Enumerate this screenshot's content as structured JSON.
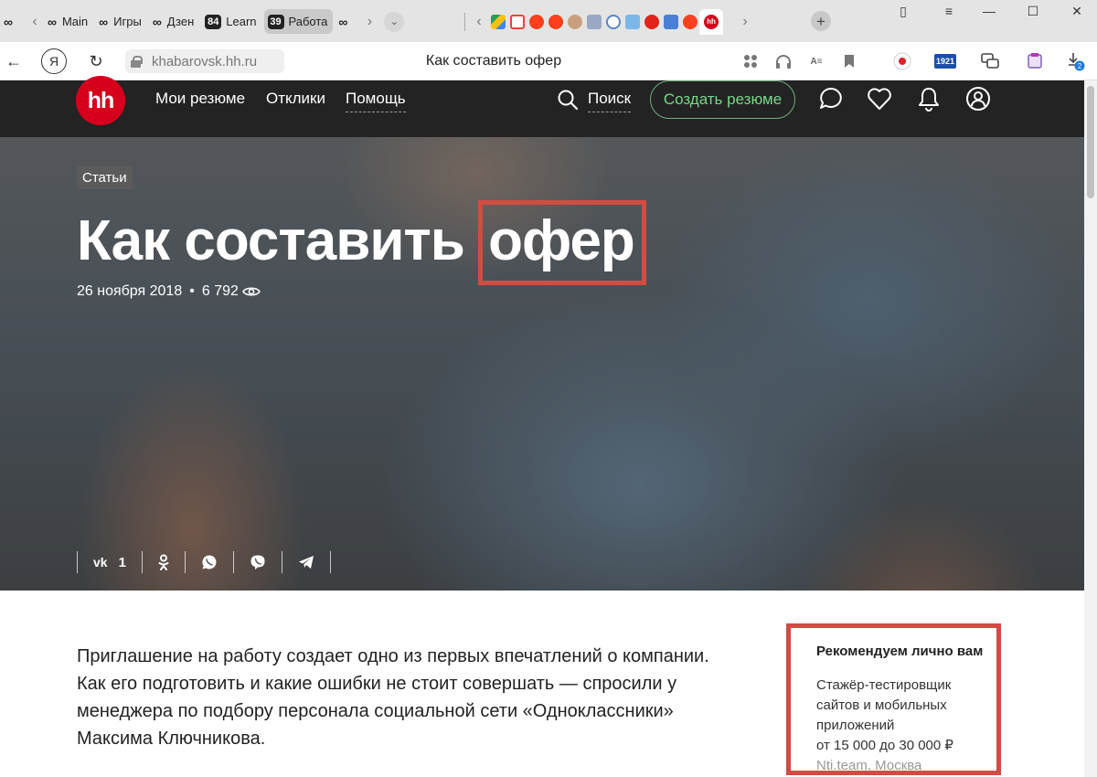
{
  "browser": {
    "tabs_left": [
      {
        "icon": "infinity-icon",
        "label": ""
      },
      {
        "icon": "infinity-icon",
        "label": "Main"
      },
      {
        "icon": "infinity-icon",
        "label": "Игры"
      },
      {
        "icon": "infinity-icon",
        "label": "Дзен"
      },
      {
        "badge": "84",
        "label": "Learn"
      },
      {
        "badge": "39",
        "label": "Работа"
      },
      {
        "icon": "infinity-icon",
        "label": ""
      }
    ],
    "pinned_favicons": [
      "google-drive",
      "gmail",
      "yandex",
      "yandex",
      "avatar",
      "image",
      "search",
      "snowflake",
      "yandex-browser",
      "docs",
      "yandex",
      "hh"
    ],
    "active_favicon_text": "hh",
    "new_tab": "+",
    "url": "khabarovsk.hh.ru",
    "page_title": "Как составить офер",
    "yandex_glyph": "Я",
    "calendar_badge": "1921",
    "download_count": "2"
  },
  "site": {
    "logo_text": "hh",
    "nav": {
      "resumes": "Мои резюме",
      "responses": "Отклики",
      "help": "Помощь"
    },
    "search_label": "Поиск",
    "create_resume": "Создать резюме",
    "colors": {
      "brand_red": "#d6001c",
      "accent_green": "#7ad58a",
      "highlight_red": "#d24c42",
      "header_bg": "#232323"
    }
  },
  "article": {
    "tag": "Статьи",
    "title_main": "Как составить",
    "title_highlight": "офер",
    "date": "26 ноября 2018",
    "separator": "•",
    "views": "6 792",
    "share": {
      "vk_label": "vk",
      "vk_count": "1"
    },
    "lead": "Приглашение на работу создает одно из первых впечатлений о компании. Как его подготовить и какие ошибки не стоит совершать — спросили у менеджера по подбору персонала социальной сети «Одноклассники» Максима Ключникова."
  },
  "recommendation": {
    "title": "Рекомендуем лично вам",
    "job_title": "Стажёр-тестировщик сайтов и мобильных приложений",
    "salary": "от 15 000 до 30 000 ₽",
    "company": "Nti.team, Москва"
  }
}
